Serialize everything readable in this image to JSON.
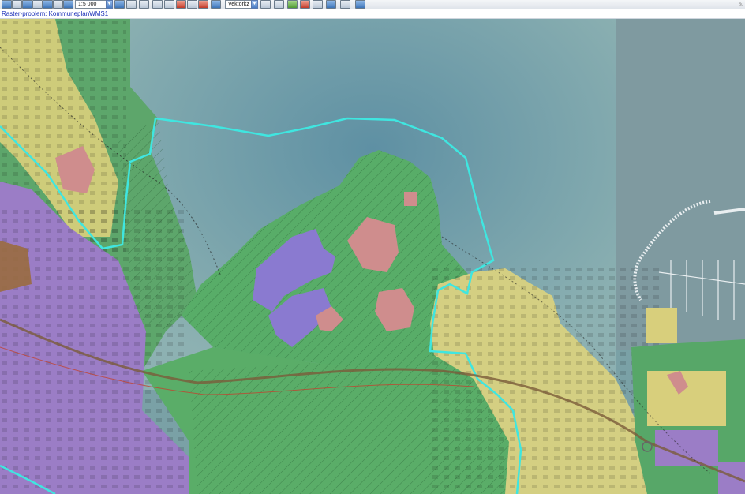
{
  "toolbar": {
    "scale_value": "1:5 000",
    "layer_select_value": "Vektorkz",
    "right_tag": "Bu"
  },
  "status": {
    "raster_problem_link": "Raster-problem: KommuneplanWMS1"
  },
  "map": {
    "colors": {
      "sea": "#6f9aa0",
      "nature_green": "#5fae68",
      "residential_yellow": "#d9d27a",
      "industry_purple": "#9a7cc4",
      "public_pink": "#cc8a8a",
      "boundary_cyan": "#3fe6e0"
    }
  }
}
